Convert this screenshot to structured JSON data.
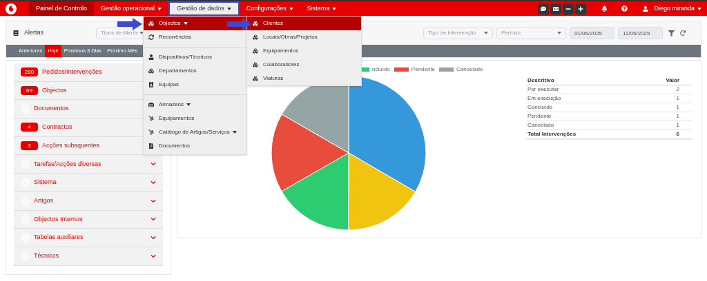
{
  "navbar": {
    "items": [
      {
        "label": "Painel de Controlo",
        "kind": "link",
        "selected": true,
        "open": false
      },
      {
        "label": "Gestão operacional",
        "kind": "dropdown",
        "selected": false,
        "open": false
      },
      {
        "label": "Gestão de dados",
        "kind": "dropdown",
        "selected": false,
        "open": true
      },
      {
        "label": "Configurações",
        "kind": "dropdown",
        "selected": false,
        "open": false
      },
      {
        "label": "Sistema",
        "kind": "dropdown",
        "selected": false,
        "open": false
      }
    ],
    "user": "Diego miranda"
  },
  "menu": {
    "items": [
      {
        "label": "Objectos",
        "kind": "submenu",
        "selected": true
      },
      {
        "label": "Recorrências",
        "kind": "link",
        "selected": false
      },
      {
        "kind": "divider"
      },
      {
        "label": "Dispositivos/Técnicos",
        "kind": "link",
        "selected": false
      },
      {
        "label": "Departamentos",
        "kind": "link",
        "selected": false
      },
      {
        "label": "Equipas",
        "kind": "link",
        "selected": false
      },
      {
        "kind": "divider"
      },
      {
        "label": "Armazéns",
        "kind": "submenu",
        "selected": false
      },
      {
        "label": "Equipamentos",
        "kind": "link",
        "selected": false
      },
      {
        "label": "Catálogo de Artigos/Serviços",
        "kind": "submenu",
        "selected": false
      },
      {
        "label": "Documentos",
        "kind": "link",
        "selected": false
      }
    ],
    "submenu": [
      {
        "label": "Clientes",
        "selected": true
      },
      {
        "label": "Locais/Obras/Projetos",
        "selected": false
      },
      {
        "label": "Equipamentos",
        "selected": false
      },
      {
        "label": "Colaboradores",
        "selected": false
      },
      {
        "label": "Viaturas",
        "selected": false
      }
    ]
  },
  "alerts": {
    "title": "Alertas",
    "type_filter": {
      "placeholder": "Tipos de Alerta"
    },
    "tabs": [
      {
        "label": "Anteriores",
        "selected": false
      },
      {
        "label": "Hoje",
        "selected": true
      },
      {
        "label": "Próximos 3 Dias",
        "selected": false
      },
      {
        "label": "Próximo Mês",
        "selected": false
      }
    ],
    "items": [
      {
        "label": "Pedidos/Intervenções",
        "count": "280"
      },
      {
        "label": "Objectos",
        "count": "69"
      },
      {
        "label": "Documentos"
      },
      {
        "label": "Contractos",
        "count": "4"
      },
      {
        "label": "Acções subsquentes",
        "count": "3"
      },
      {
        "label": "Tarefas/Acções diversas",
        "chevron": true
      },
      {
        "label": "Sistema",
        "chevron": true
      },
      {
        "label": "Artigos",
        "chevron": true
      },
      {
        "label": "Objectos Internos",
        "chevron": true
      },
      {
        "label": "Tabelas auxiliares",
        "chevron": true
      },
      {
        "label": "Técnicos",
        "chevron": true
      }
    ]
  },
  "filters": {
    "intervention_type": {
      "placeholder": "Tipo de intervenção"
    },
    "period": {
      "placeholder": "Período"
    },
    "date_from": "01/06/2025",
    "date_to": "11/06/2025"
  },
  "chart": {
    "legend": [
      {
        "label": "ncluído",
        "color": "#2ecc71"
      },
      {
        "label": "Pendente",
        "color": "#e74c3c"
      },
      {
        "label": "Cancelado",
        "color": "#95a5a6"
      }
    ],
    "chart_data": {
      "type": "pie",
      "values": [
        33.4,
        16.65,
        16.65,
        16.65,
        16.65
      ]
    }
  },
  "table": {
    "columns": [
      "Descritivo",
      "Valor"
    ],
    "rows": [
      [
        "Por executar",
        "2"
      ],
      [
        "Em execução",
        "1"
      ],
      [
        "Concluído",
        "1"
      ],
      [
        "Pendente",
        "1"
      ],
      [
        "Cancelado",
        "1"
      ]
    ],
    "total": [
      "Total Intervenções",
      "6"
    ]
  }
}
